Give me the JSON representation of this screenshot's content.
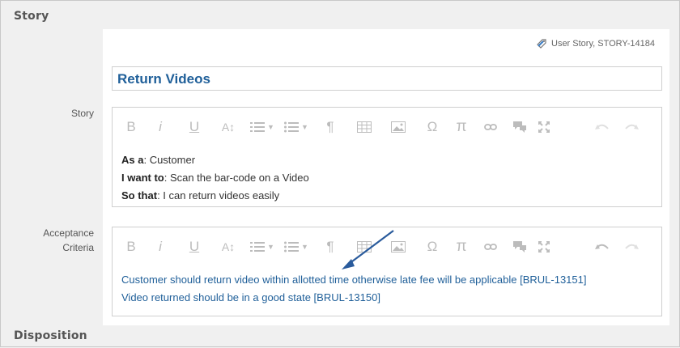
{
  "sections": {
    "story_title": "Story",
    "disposition_title": "Disposition"
  },
  "asset": {
    "reference": "User Story, STORY-14184",
    "icon": "tag-icon"
  },
  "title_field": {
    "value": "Return Videos"
  },
  "fields": {
    "story_label": "Story",
    "acceptance_label_line1": "Acceptance",
    "acceptance_label_line2": "Criteria"
  },
  "toolbar": {
    "bold": "B",
    "italic": "i",
    "underline": "U",
    "font_size": "A↕",
    "paragraph": "¶",
    "special_char": "Ω",
    "math": "π"
  },
  "story": {
    "lines": [
      {
        "label": "As a",
        "text": ": Customer"
      },
      {
        "label": "I want to",
        "text": ": Scan the bar-code on a Video"
      },
      {
        "label": "So that",
        "text": ": I can return videos easily"
      }
    ]
  },
  "acceptance": {
    "lines": [
      "Customer should return video within allotted time otherwise late fee will be applicable [BRUL-13151]",
      "Video returned should be in a good state [BRUL-13150]"
    ]
  },
  "colors": {
    "title": "#1f5f99",
    "link_text": "#1f5f99",
    "arrow": "#2a5b9c",
    "toolbar_disabled": "#bcbcbc"
  }
}
